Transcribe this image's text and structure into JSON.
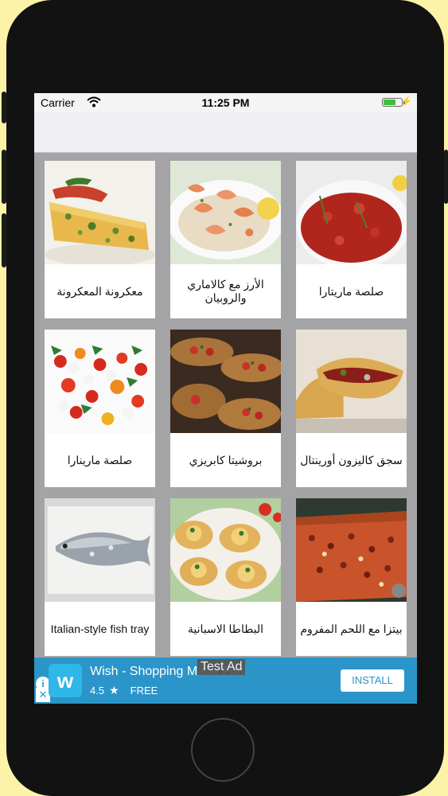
{
  "status_bar": {
    "carrier": "Carrier",
    "time": "11:25 PM",
    "battery_level": 0.7
  },
  "recipes": [
    {
      "title": "معكرونة المعكرونة",
      "image": "frittata-photo"
    },
    {
      "title": "الأرز مع كالاماري والروبيان",
      "image": "shrimp-rice-photo"
    },
    {
      "title": "صلصة ماريتارا",
      "image": "marinara-sauce-photo"
    },
    {
      "title": "صلصة مارينارا",
      "image": "caprese-salad-photo"
    },
    {
      "title": "بروشيتا كابريزي",
      "image": "bruschetta-photo"
    },
    {
      "title": "سجق كاليزون أورينتال",
      "image": "calzone-photo"
    },
    {
      "title": "Italian-style fish tray",
      "image": "salt-baked-fish-photo"
    },
    {
      "title": "البطاطا الاسبانية",
      "image": "mini-pizza-photo"
    },
    {
      "title": "بيتزا مع اللحم المفروم",
      "image": "minced-meat-pizza-photo"
    }
  ],
  "ad": {
    "test_label": "Test Ad",
    "title": "Wish - Shopping Made Fun",
    "rating": "4.5",
    "star": "★",
    "price": "FREE",
    "install_label": "INSTALL",
    "logo_letter": "w",
    "info_icon": "i",
    "close_icon": "✕"
  },
  "colors": {
    "ad_background": "#2b95c9",
    "grid_background": "#a4a4a6",
    "page_background": "#fdf3a8"
  }
}
